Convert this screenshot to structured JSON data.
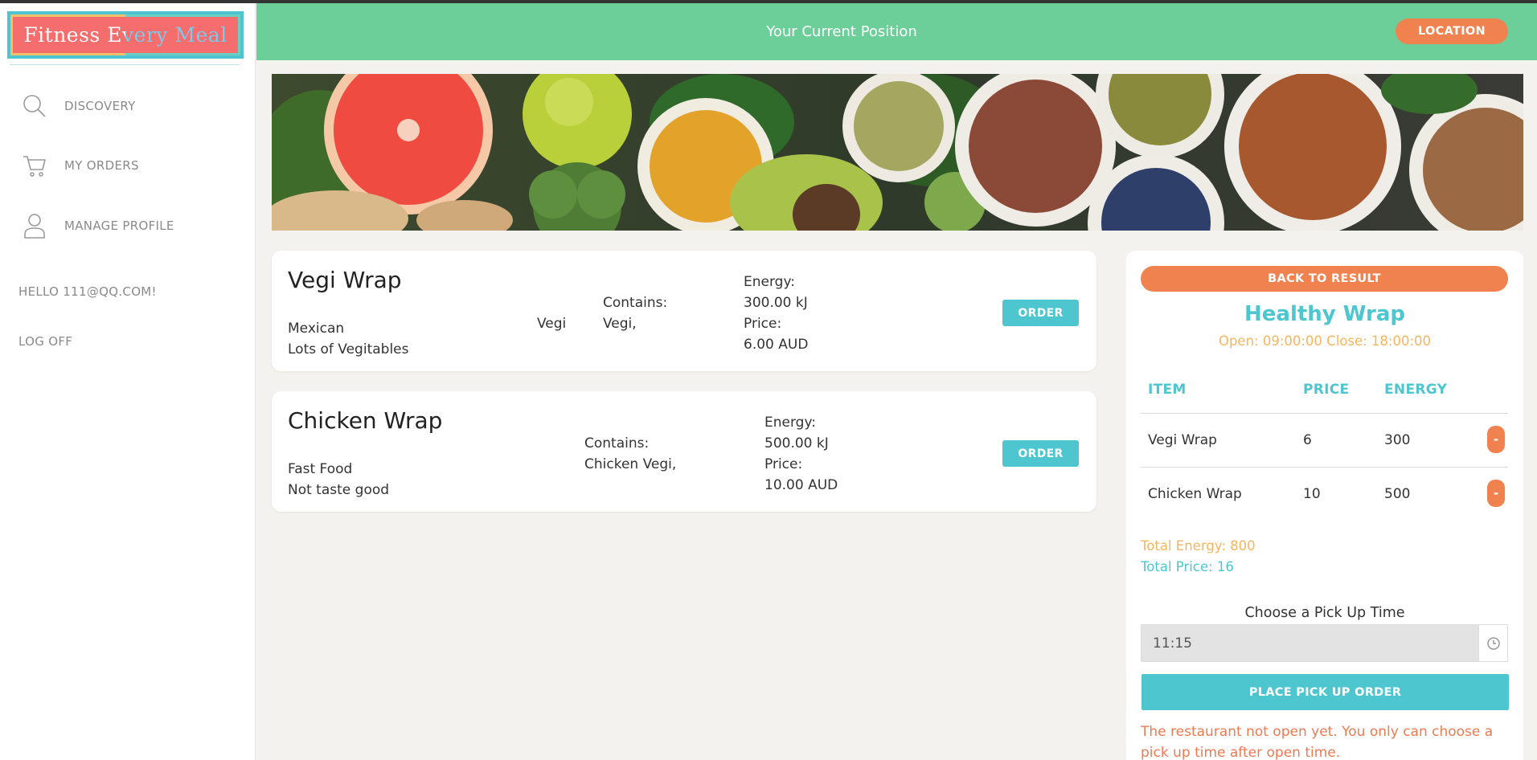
{
  "sidebar": {
    "logo_text": "Fitness Every Meal",
    "nav": [
      {
        "label": "DISCOVERY",
        "icon": "search-icon"
      },
      {
        "label": "MY ORDERS",
        "icon": "cart-icon"
      },
      {
        "label": "MANAGE PROFILE",
        "icon": "user-icon"
      }
    ],
    "greeting": "HELLO 111@QQ.COM!",
    "logoff": "LOG OFF"
  },
  "header": {
    "title": "Your Current Position",
    "location_button": "LOCATION",
    "color": "#6ccf99"
  },
  "menu_items": [
    {
      "name": "Vegi Wrap",
      "cuisine": "Mexican",
      "description": "Lots of Vegitables",
      "tag": "Vegi",
      "contains_label": "Contains:",
      "contains": "Vegi,",
      "energy_label": "Energy:",
      "energy": "300.00 kJ",
      "price_label": "Price:",
      "price": "6.00 AUD",
      "button": "ORDER"
    },
    {
      "name": "Chicken Wrap",
      "cuisine": "Fast Food",
      "description": "Not taste good",
      "tag": "",
      "contains_label": "Contains:",
      "contains": "Chicken Vegi,",
      "energy_label": "Energy:",
      "energy": "500.00 kJ",
      "price_label": "Price:",
      "price": "10.00 AUD",
      "button": "ORDER"
    }
  ],
  "order_panel": {
    "back_button": "BACK TO RESULT",
    "restaurant_name": "Healthy Wrap",
    "hours": "Open: 09:00:00 Close: 18:00:00",
    "columns": [
      "ITEM",
      "PRICE",
      "ENERGY"
    ],
    "rows": [
      {
        "item": "Vegi Wrap",
        "price": "6",
        "energy": "300",
        "remove": "-"
      },
      {
        "item": "Chicken Wrap",
        "price": "10",
        "energy": "500",
        "remove": "-"
      }
    ],
    "total_energy": "Total Energy: 800",
    "total_price": "Total Price: 16",
    "pickup_label": "Choose a Pick Up Time",
    "pickup_time": "11:15",
    "place_button": "PLACE PICK UP ORDER",
    "warning": "The restaurant not open yet. You only can choose a pick up time after open time."
  },
  "colors": {
    "accent_teal": "#4dc6cf",
    "accent_orange": "#f0824f",
    "accent_yellow": "#f6b65f"
  }
}
